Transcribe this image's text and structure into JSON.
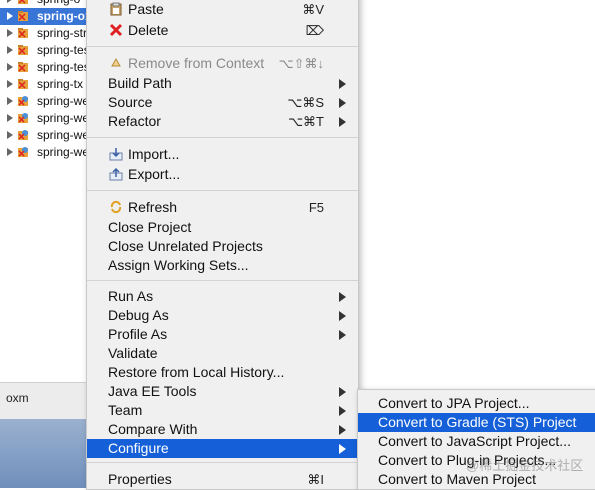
{
  "tree": {
    "items": [
      {
        "label": "spring-o"
      },
      {
        "label": "spring-ox",
        "selected": true
      },
      {
        "label": "spring-str"
      },
      {
        "label": "spring-tes"
      },
      {
        "label": "spring-tes"
      },
      {
        "label": "spring-tx"
      },
      {
        "label": "spring-we"
      },
      {
        "label": "spring-we"
      },
      {
        "label": "spring-we"
      },
      {
        "label": "spring-we"
      }
    ]
  },
  "bottom": {
    "tab_label": "oxm"
  },
  "menu": {
    "paste": {
      "label": "Paste",
      "shortcut": "⌘V",
      "icon": "clipboard-icon"
    },
    "delete": {
      "label": "Delete",
      "shortcut": "⌦",
      "icon": "red-x-icon"
    },
    "remove_context": {
      "label": "Remove from Context",
      "shortcut": "⌥⇧⌘↓",
      "disabled": true
    },
    "build_path": {
      "label": "Build Path"
    },
    "source": {
      "label": "Source",
      "shortcut": "⌥⌘S"
    },
    "refactor": {
      "label": "Refactor",
      "shortcut": "⌥⌘T"
    },
    "import": {
      "label": "Import..."
    },
    "export": {
      "label": "Export..."
    },
    "refresh": {
      "label": "Refresh",
      "shortcut": "F5"
    },
    "close_project": {
      "label": "Close Project"
    },
    "close_unrelated": {
      "label": "Close Unrelated Projects"
    },
    "assign_working_sets": {
      "label": "Assign Working Sets..."
    },
    "run_as": {
      "label": "Run As"
    },
    "debug_as": {
      "label": "Debug As"
    },
    "profile_as": {
      "label": "Profile As"
    },
    "validate": {
      "label": "Validate"
    },
    "restore_history": {
      "label": "Restore from Local History..."
    },
    "java_ee_tools": {
      "label": "Java EE Tools"
    },
    "team": {
      "label": "Team"
    },
    "compare_with": {
      "label": "Compare With"
    },
    "configure": {
      "label": "Configure"
    },
    "properties": {
      "label": "Properties",
      "shortcut": "⌘I"
    }
  },
  "submenu": {
    "items": [
      {
        "label": "Convert to JPA Project..."
      },
      {
        "label": "Convert to Gradle (STS) Project",
        "active": true
      },
      {
        "label": "Convert to JavaScript Project..."
      },
      {
        "label": "Convert to Plug-in Projects..."
      },
      {
        "label": "Convert to Maven Project"
      }
    ]
  },
  "watermark": "@稀土掘金技术社区",
  "colors": {
    "selection": "#1560d8",
    "menu_bg": "#f0f0f0",
    "tree_selected": "#3875d7"
  }
}
